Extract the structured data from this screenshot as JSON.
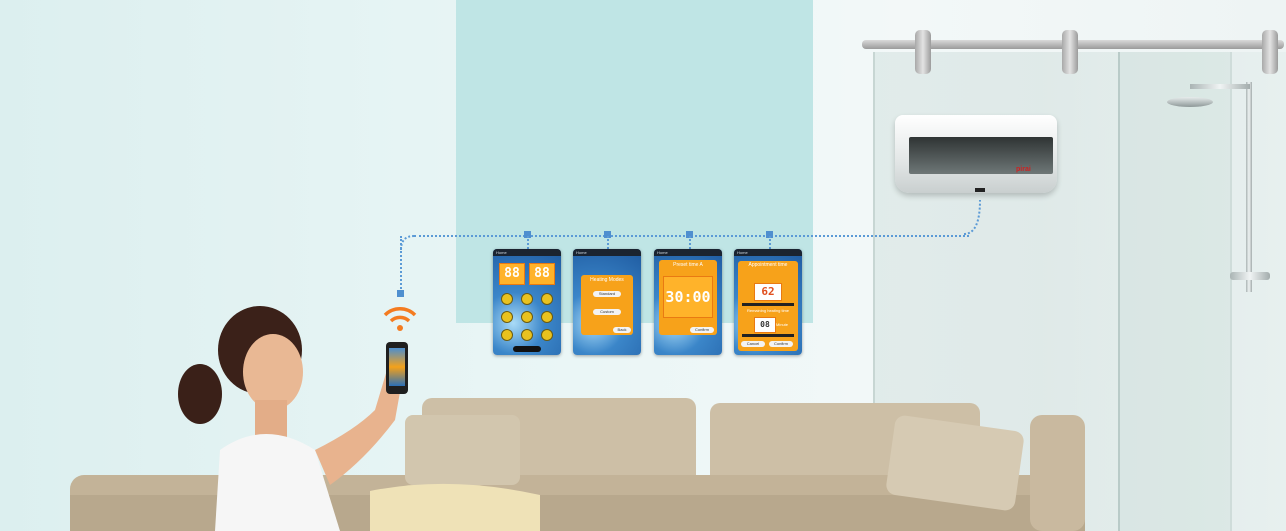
{
  "scene": {
    "description_elements": [
      "living-room",
      "sofa",
      "woman-with-phone",
      "water-heater",
      "shower-enclosure"
    ],
    "colors": {
      "panel": "#bfe5e5",
      "connector": "#5b9ad6",
      "wifi": "#f47b20",
      "accent_orange": "#f7a21a"
    }
  },
  "heater": {
    "brand": "pirai"
  },
  "screens": [
    {
      "header": "Home",
      "display_left": "88",
      "display_right": "88"
    },
    {
      "header": "Home",
      "title": "Heating Modes",
      "button1": "Standard",
      "button2": "Custom",
      "back": "Back"
    },
    {
      "header": "Home",
      "title": "Preset time A",
      "time": "30:00",
      "confirm": "Confirm"
    },
    {
      "header": "Home",
      "title": "Appointment time",
      "value": "62",
      "label": "Remaining heating time",
      "value2": "08",
      "unit": "Minute",
      "btn1": "Cancel",
      "btn2": "Confirm"
    }
  ]
}
